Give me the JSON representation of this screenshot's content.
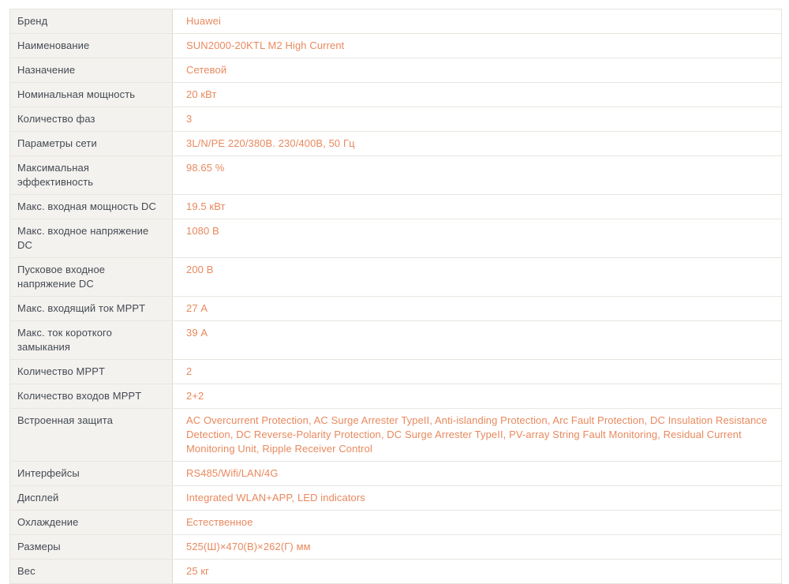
{
  "colors": {
    "label_bg": "#f4f2ee",
    "value_bg": "#ffffff",
    "row_border": "#e9e6e0",
    "column_divider": "#dedbd4",
    "outer_border": "#e6e3dd",
    "label_text": "#434a54",
    "value_text": "#e8895e"
  },
  "table": {
    "rows": [
      {
        "label": "Бренд",
        "value": "Huawei"
      },
      {
        "label": "Наименование",
        "value": "SUN2000-20KTL M2 High Current"
      },
      {
        "label": "Назначение",
        "value": "Сетевой"
      },
      {
        "label": "Номинальная мощность",
        "value": "20 кВт"
      },
      {
        "label": "Количество фаз",
        "value": "3"
      },
      {
        "label": "Параметры сети",
        "value": "3L/N/PE 220/380В. 230/400В, 50 Гц"
      },
      {
        "label": "Максимальная эффективность",
        "value": "98.65 %"
      },
      {
        "label": "Макс. входная мощность DC",
        "value": "19.5 кВт"
      },
      {
        "label": "Макс. входное напряжение DC",
        "value": "1080 В"
      },
      {
        "label": "Пусковое входное напряжение DC",
        "value": "200 В"
      },
      {
        "label": "Макс. входящий ток MPPT",
        "value": "27 А"
      },
      {
        "label": "Макс. ток короткого замыкания",
        "value": "39 А"
      },
      {
        "label": "Количество MPPT",
        "value": "2"
      },
      {
        "label": "Количество входов MPPT",
        "value": "2+2"
      },
      {
        "label": "Встроенная защита",
        "value": "AC Overcurrent Protection, AC Surge Arrester TypeII, Anti-islanding Protection, Arc Fault Protection, DC Insulation Resistance Detection, DC Reverse-Polarity Protection, DC Surge Arrester TypeII, PV-array String Fault Monitoring, Residual Current Monitoring Unit, Ripple Receiver Control"
      },
      {
        "label": "Интерфейсы",
        "value": "RS485/Wifi/LAN/4G"
      },
      {
        "label": "Дисплей",
        "value": "Integrated WLAN+APP, LED indicators"
      },
      {
        "label": "Охлаждение",
        "value": "Естественное"
      },
      {
        "label": "Размеры",
        "value": "525(Ш)×470(В)×262(Г) мм"
      },
      {
        "label": "Вес",
        "value": "25 кг"
      }
    ]
  }
}
